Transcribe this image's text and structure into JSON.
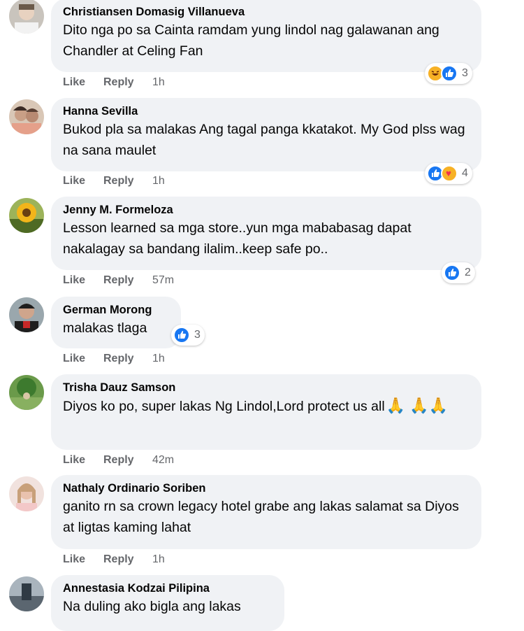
{
  "actions": {
    "like": "Like",
    "reply": "Reply"
  },
  "comments": [
    {
      "author": "Christiansen Domasig Villanueva",
      "text": "Dito nga po sa Cainta ramdam yung lindol nag galawanan ang Chandler at Celing Fan",
      "time": "1h",
      "reactions": [
        "haha",
        "like"
      ],
      "count": "3"
    },
    {
      "author": "Hanna Sevilla",
      "text": "Bukod pla sa malakas Ang tagal panga kkatakot. My God plss wag na sana maulet",
      "time": "1h",
      "reactions": [
        "like",
        "care"
      ],
      "count": "4"
    },
    {
      "author": "Jenny M. Formeloza",
      "text": "Lesson learned sa mga store..yun mga mababasag dapat nakalagay sa bandang ilalim..keep safe po..",
      "time": "57m",
      "reactions": [
        "like"
      ],
      "count": "2"
    },
    {
      "author": "German Morong",
      "text": "malakas tlaga",
      "time": "1h",
      "reactions": [
        "like"
      ],
      "count": "3"
    },
    {
      "author": "Trisha Dauz Samson",
      "text": "Diyos ko po, super lakas Ng Lindol,Lord protect us all",
      "time": "42m",
      "emoji_line": "🙏 🙏🙏"
    },
    {
      "author": "Nathaly Ordinario Soriben",
      "text": "ganito rn sa crown legacy hotel grabe ang lakas salamat sa Diyos at ligtas kaming lahat",
      "time": "1h"
    },
    {
      "author": "Annestasia Kodzai Pilipina",
      "text": "Na duling ako bigla ang lakas"
    }
  ]
}
